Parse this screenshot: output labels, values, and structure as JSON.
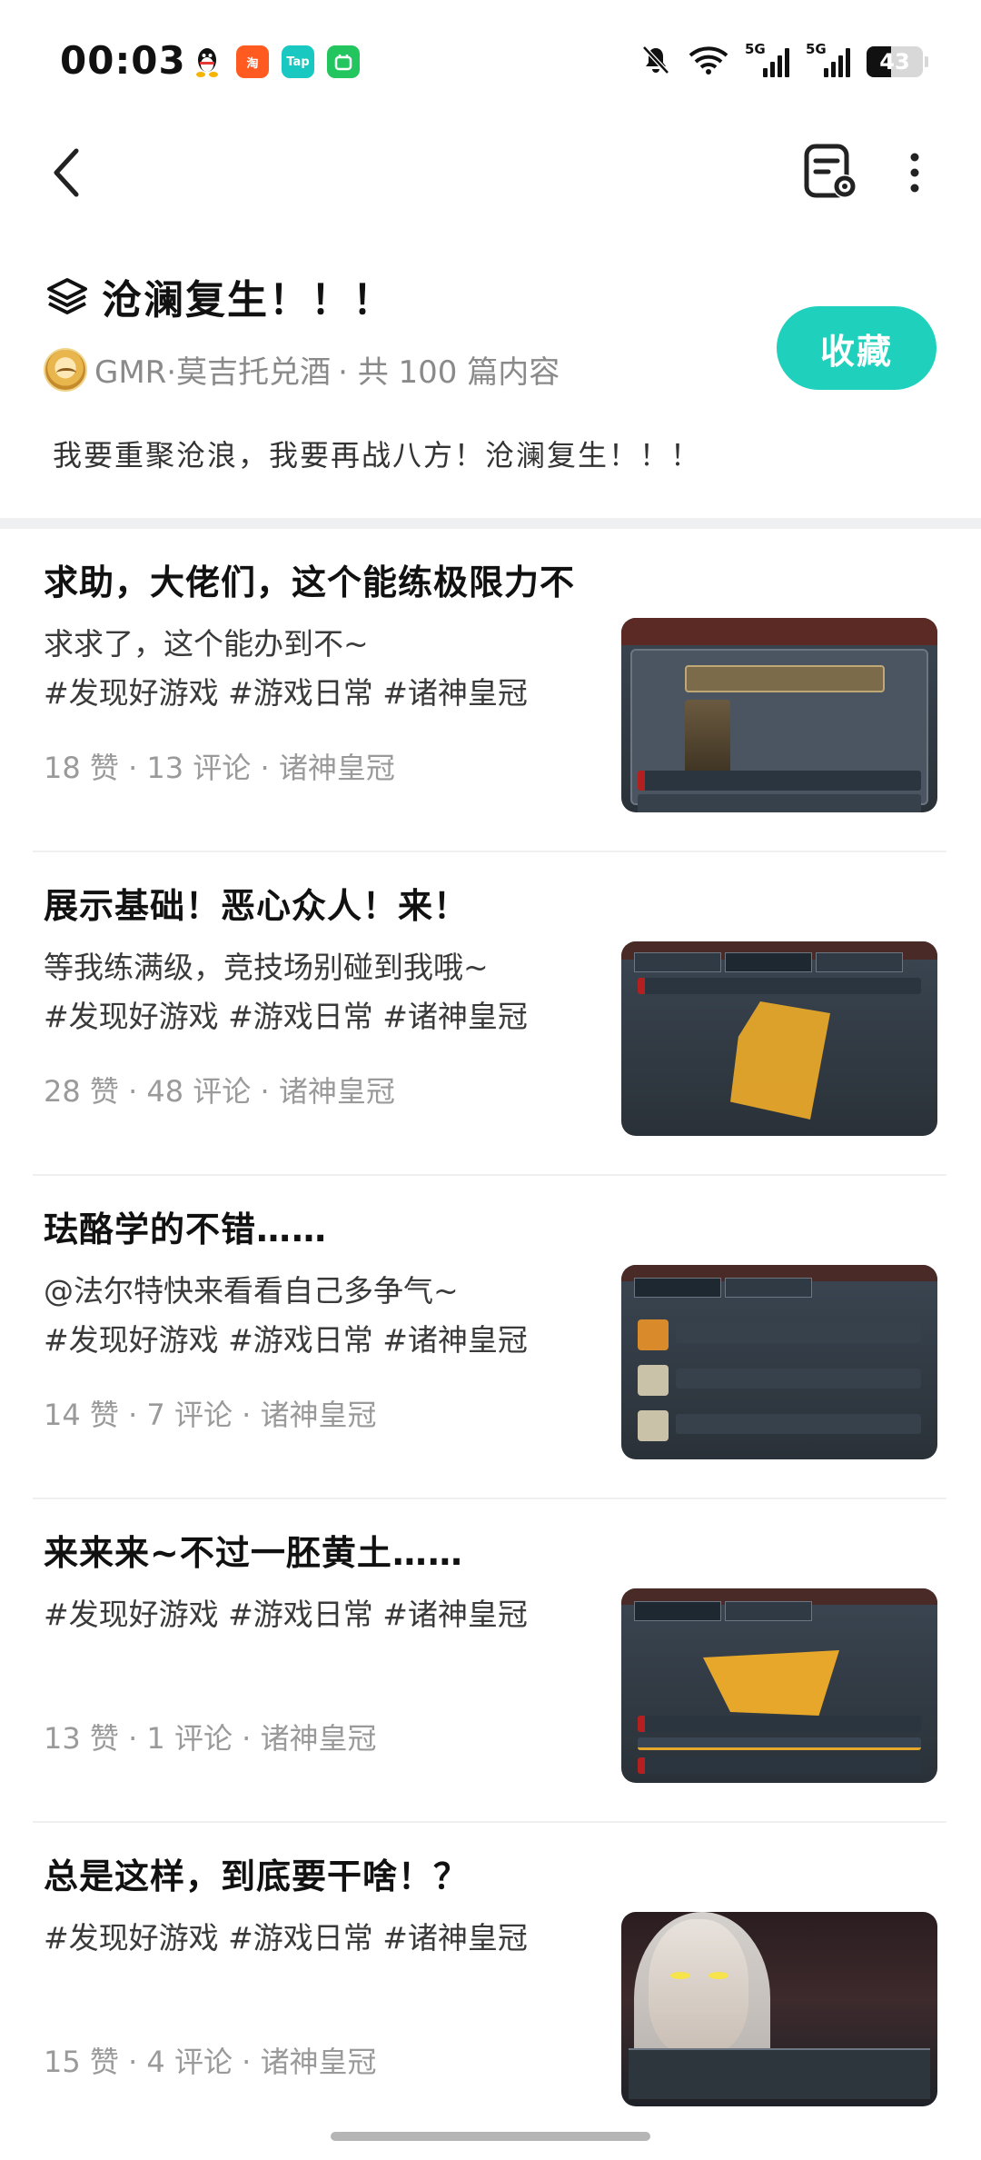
{
  "status_bar": {
    "time": "00:03",
    "notification_icons": [
      "qq-icon",
      "taobao-icon",
      "taptap-icon",
      "green-app-icon"
    ],
    "taptap_label": "Tap",
    "taobao_label": "淘",
    "signal_labels": [
      "5G",
      "5G"
    ],
    "battery_level": "43"
  },
  "header": {
    "back_icon": "chevron-left-icon",
    "settings_icon": "note-settings-icon",
    "more_icon": "more-vertical-icon"
  },
  "collection": {
    "icon": "layers-icon",
    "title": "沧澜复生！！！",
    "author": "GMR·莫吉托兑酒",
    "count_text": "· 共 100 篇内容",
    "collect_label": "收藏",
    "description": "我要重聚沧浪，我要再战八方！沧澜复生！！！",
    "accent_color": "#1fd1bd"
  },
  "posts": [
    {
      "title": "求助，大佬们，这个能练极限力不",
      "text_lines": [
        "求求了，这个能办到不~",
        "#发现好游戏 #游戏日常 #诸神皇冠"
      ],
      "meta": "18 赞 · 13 评论 · 诸神皇冠"
    },
    {
      "title": "展示基础！恶心众人！来！",
      "text_lines": [
        "等我练满级，竞技场别碰到我哦~",
        "#发现好游戏 #游戏日常 #诸神皇冠"
      ],
      "meta": "28 赞 · 48 评论 · 诸神皇冠"
    },
    {
      "title": "珐酪学的不错……",
      "text_lines": [
        "@法尔特快来看看自己多争气~",
        "#发现好游戏 #游戏日常 #诸神皇冠"
      ],
      "meta": "14 赞 · 7 评论 · 诸神皇冠"
    },
    {
      "title": "来来来~不过一胚黄土……",
      "text_lines": [
        "#发现好游戏 #游戏日常 #诸神皇冠",
        ""
      ],
      "meta": "13 赞 · 1 评论 · 诸神皇冠"
    },
    {
      "title": "总是这样，到底要干啥！？",
      "text_lines": [
        "#发现好游戏 #游戏日常 #诸神皇冠",
        ""
      ],
      "meta": "15 赞 · 4 评论 · 诸神皇冠"
    }
  ]
}
